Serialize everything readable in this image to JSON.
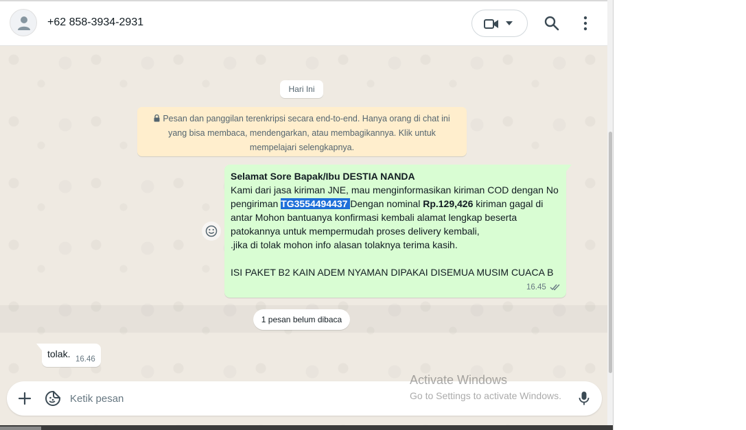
{
  "header": {
    "contact_name": "+62 858-3934-2931",
    "icons": {
      "avatar": "person-icon",
      "video": "video-camera-icon",
      "video_menu": "chevron-down-icon",
      "search": "search-icon",
      "menu": "more-vertical-icon"
    }
  },
  "chat": {
    "date_label": "Hari Ini",
    "encryption_notice": "Pesan dan panggilan terenkripsi secara end-to-end. Hanya orang di chat ini yang bisa membaca, mendengarkan, atau membagikannya. Klik untuk mempelajari selengkapnya.",
    "outgoing": {
      "greeting": "Selamat Sore Bapak/Ibu DESTIA NANDA",
      "line1": "Kami dari jasa kiriman JNE, mau menginformasikan kiriman COD dengan No pengiriman ",
      "tracking": "TG3554494437 ",
      "line2": "Dengan nominal ",
      "amount": "Rp.129,426",
      "line3": " kiriman gagal di antar Mohon bantuanya konfirmasi kembali alamat lengkap beserta patokannya untuk mempermudah proses delivery kembali,",
      "line4": " .jika di tolak mohon info alasan tolaknya terima kasih.",
      "line5": "ISI PAKET B2 KAIN ADEM NYAMAN DIPAKAI DISEMUA MUSIM CUACA B",
      "time": "16.45"
    },
    "unread_label": "1 pesan belum dibaca",
    "incoming": {
      "text": "tolak.",
      "time": "16.46"
    }
  },
  "composer": {
    "placeholder": "Ketik pesan",
    "icons": {
      "attach": "plus-icon",
      "sticker": "sticker-icon",
      "mic": "microphone-icon"
    }
  },
  "watermark": {
    "line1": "Activate Windows",
    "line2": "Go to Settings to activate Windows."
  },
  "colors": {
    "outgoing_bubble": "#d9fdd3",
    "notice_bg": "#ffeecd",
    "chat_bg": "#efeae2",
    "highlight": "#1e6fd9"
  }
}
